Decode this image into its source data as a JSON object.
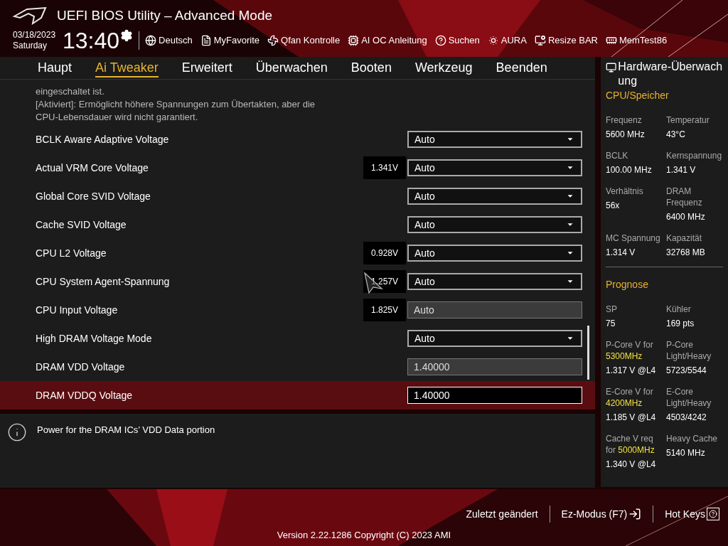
{
  "header": {
    "title": "UEFI BIOS Utility – Advanced Mode",
    "date": "03/18/2023",
    "weekday": "Saturday",
    "time": "13:40",
    "tools": [
      {
        "kind": "globe",
        "label": "Deutsch"
      },
      {
        "kind": "list",
        "label": "MyFavorite"
      },
      {
        "kind": "fan",
        "label": "Qfan Kontrolle"
      },
      {
        "kind": "chip",
        "label": "AI OC Anleitung"
      },
      {
        "kind": "help",
        "label": "Suchen"
      },
      {
        "kind": "aura",
        "label": "AURA"
      },
      {
        "kind": "resize",
        "label": "Resize BAR"
      },
      {
        "kind": "memory",
        "label": "MemTest86"
      }
    ]
  },
  "tabs": [
    {
      "label": "Haupt",
      "selected": false
    },
    {
      "label": "Ai Tweaker",
      "selected": true
    },
    {
      "label": "Erweitert",
      "selected": false
    },
    {
      "label": "Überwachen",
      "selected": false
    },
    {
      "label": "Booten",
      "selected": false
    },
    {
      "label": "Werkzeug",
      "selected": false
    },
    {
      "label": "Beenden",
      "selected": false
    }
  ],
  "description_lines": [
    "eingeschaltet ist.",
    "[Aktiviert]: Ermöglicht höhere Spannungen zum Übertakten, aber die",
    "CPU-Lebensdauer wird nicht garantiert."
  ],
  "settings": [
    {
      "label": "BCLK Aware Adaptive Voltage",
      "kind": "dropdown",
      "value": "Auto",
      "selected": false
    },
    {
      "label": "Actual VRM Core Voltage",
      "kind": "dropdown",
      "reading": "1.341V",
      "value": "Auto",
      "selected": false
    },
    {
      "label": "Global Core SVID Voltage",
      "kind": "dropdown",
      "value": "Auto",
      "selected": false
    },
    {
      "label": "Cache SVID Voltage",
      "kind": "dropdown",
      "value": "Auto",
      "selected": false
    },
    {
      "label": "CPU L2 Voltage",
      "kind": "dropdown",
      "reading": "0.928V",
      "value": "Auto",
      "selected": false
    },
    {
      "label": "CPU System Agent-Spannung",
      "kind": "dropdown",
      "reading": "1.257V",
      "value": "Auto",
      "selected": false
    },
    {
      "label": "CPU Input Voltage",
      "kind": "readonly",
      "reading": "1.825V",
      "value": "Auto",
      "selected": false
    },
    {
      "label": "High DRAM Voltage Mode",
      "kind": "dropdown",
      "value": "Auto",
      "selected": false
    },
    {
      "label": "DRAM VDD Voltage",
      "kind": "input",
      "value": "1.40000",
      "selected": false
    },
    {
      "label": "DRAM VDDQ Voltage",
      "kind": "input",
      "value": "1.40000",
      "selected": true
    }
  ],
  "help_text": "Power for the DRAM ICs’ VDD Data portion",
  "monitor": {
    "title": "Hardware-Überwachung",
    "sections": [
      {
        "title": "CPU/Speicher",
        "items": [
          {
            "label": "Frequenz",
            "value": "5600 MHz"
          },
          {
            "label": "Temperatur",
            "value": "43°C"
          },
          {
            "label": "BCLK",
            "value": "100.00 MHz"
          },
          {
            "label": "Kernspannung",
            "value": "1.341 V"
          },
          {
            "label": "Verhältnis",
            "value": "56x"
          },
          {
            "label": "DRAM Frequenz",
            "value": "6400 MHz"
          },
          {
            "label": "MC Spannung",
            "value": "1.314 V"
          },
          {
            "label": "Kapazität",
            "value": "32768 MB"
          }
        ]
      },
      {
        "title": "Prognose",
        "items": [
          {
            "label": "SP",
            "value": "75"
          },
          {
            "label": "Kühler",
            "value": "169 pts"
          },
          {
            "label": "P-Core V for **5300MHz**",
            "value": "1.317 V @L4"
          },
          {
            "label": "P-Core Light/Heavy",
            "value": "5723/5544"
          },
          {
            "label": "E-Core V for **4200MHz**",
            "value": "1.185 V @L4"
          },
          {
            "label": "E-Core Light/Heavy",
            "value": "4503/4242"
          },
          {
            "label": "Cache V req for **5000MHz**",
            "value": "1.340 V @L4"
          },
          {
            "label": "Heavy Cache",
            "value": "5140 MHz"
          }
        ]
      }
    ]
  },
  "footer": {
    "actions": [
      {
        "kind": "text",
        "label": "Zuletzt geändert"
      },
      {
        "kind": "exit",
        "label": "Ez-Modus (F7)"
      },
      {
        "kind": "help",
        "label": "Hot Keys"
      }
    ],
    "version": "Version 2.22.1286 Copyright (C) 2023 AMI"
  }
}
